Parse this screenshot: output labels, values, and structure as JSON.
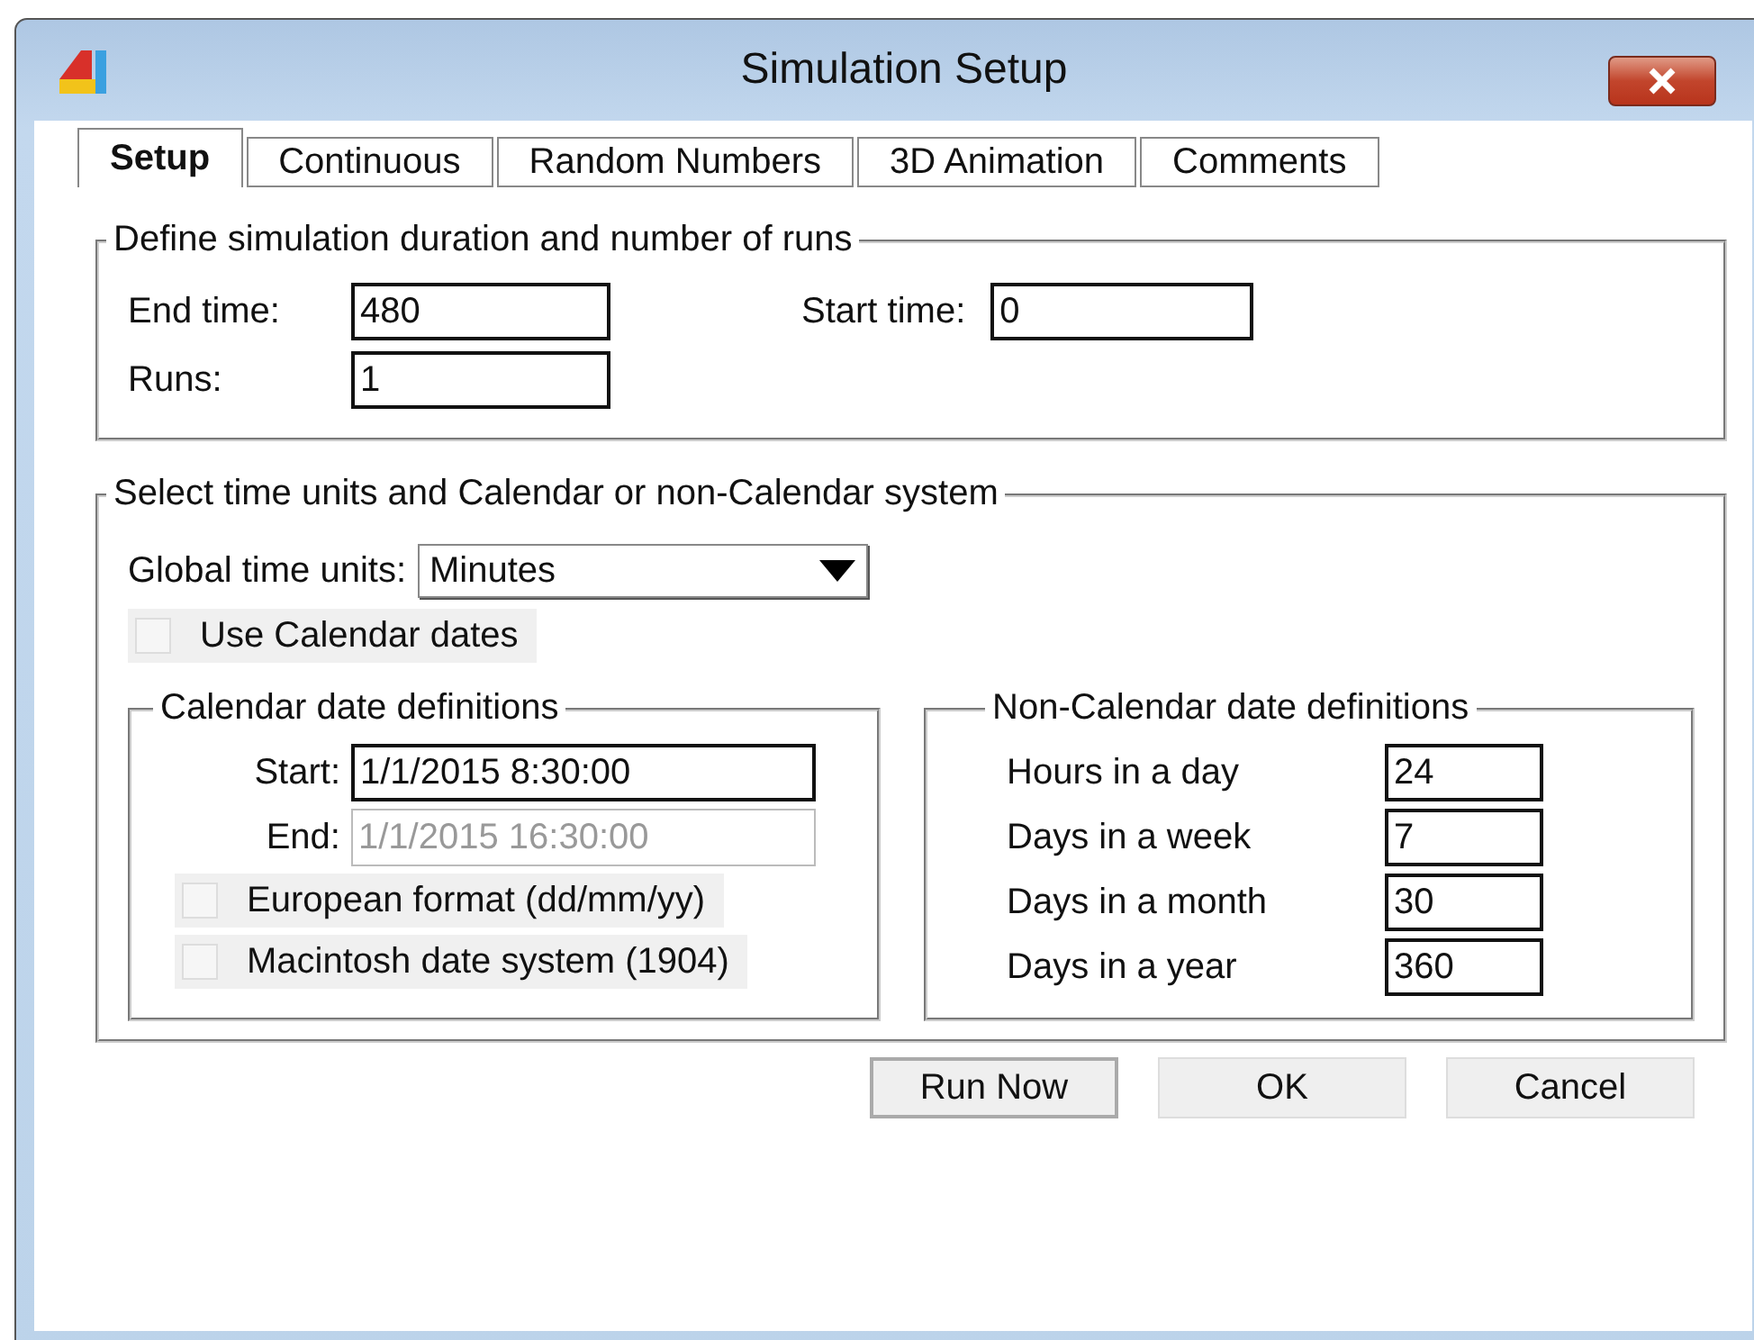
{
  "window": {
    "title": "Simulation Setup"
  },
  "tabs": [
    {
      "label": "Setup",
      "selected": true
    },
    {
      "label": "Continuous",
      "selected": false
    },
    {
      "label": "Random Numbers",
      "selected": false
    },
    {
      "label": "3D Animation",
      "selected": false
    },
    {
      "label": "Comments",
      "selected": false
    }
  ],
  "duration_group": {
    "title": "Define simulation duration and number of runs",
    "end_time": {
      "label": "End time:",
      "value": "480"
    },
    "start_time": {
      "label": "Start time:",
      "value": "0"
    },
    "runs": {
      "label": "Runs:",
      "value": "1"
    }
  },
  "time_group": {
    "title": "Select time units and Calendar or non-Calendar system",
    "global_time_units": {
      "label": "Global time units:",
      "value": "Minutes"
    },
    "use_calendar": {
      "label": "Use Calendar dates",
      "checked": false
    },
    "calendar": {
      "title": "Calendar date definitions",
      "fields": [
        {
          "label": "Start:",
          "value": "1/1/2015 8:30:00",
          "disabled": false
        },
        {
          "label": "End:",
          "value": "1/1/2015 16:30:00",
          "disabled": true
        }
      ],
      "options": [
        {
          "label": "European format (dd/mm/yy)",
          "checked": false
        },
        {
          "label": "Macintosh date system (1904)",
          "checked": false
        }
      ]
    },
    "non_calendar": {
      "title": "Non-Calendar date definitions",
      "fields": [
        {
          "label": "Hours in a day",
          "value": "24"
        },
        {
          "label": "Days in a week",
          "value": "7"
        },
        {
          "label": "Days in a month",
          "value": "30"
        },
        {
          "label": "Days in a year",
          "value": "360"
        }
      ]
    }
  },
  "buttons": [
    {
      "label": "Run Now",
      "default": true
    },
    {
      "label": "OK",
      "default": false
    },
    {
      "label": "Cancel",
      "default": false
    }
  ]
}
